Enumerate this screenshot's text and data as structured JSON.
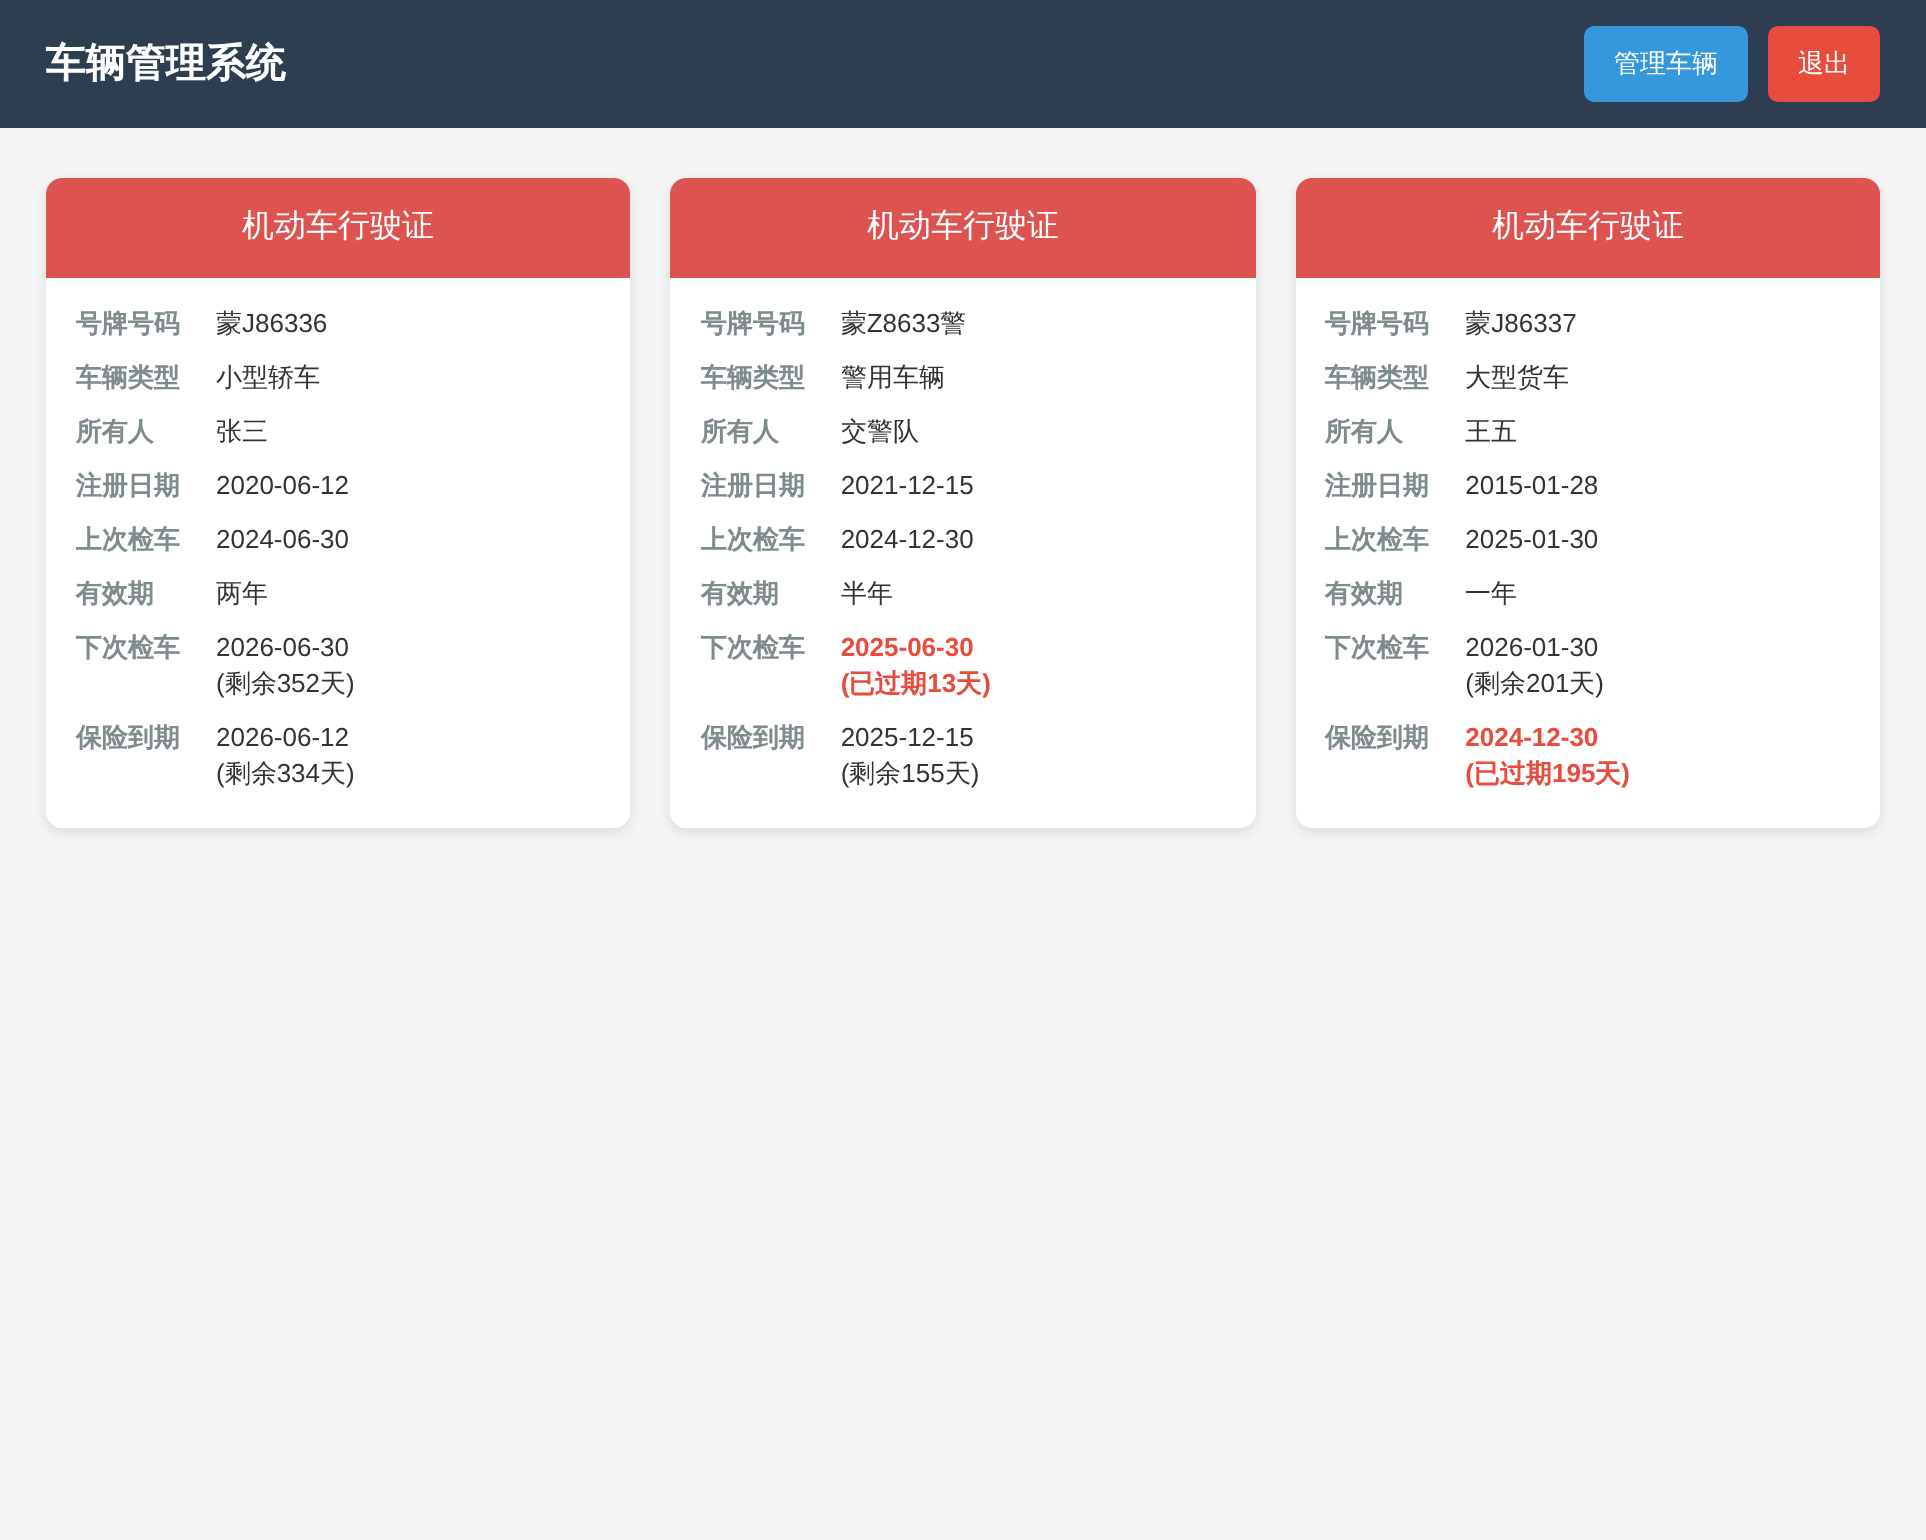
{
  "header": {
    "title": "车辆管理系统",
    "buttons": [
      {
        "label": "管理车辆",
        "kind": "primary"
      },
      {
        "label": "退出",
        "kind": "danger"
      }
    ]
  },
  "cards": [
    {
      "title": "机动车行驶证",
      "rows": [
        {
          "label": "号牌号码",
          "value": "蒙J86336",
          "expired": false
        },
        {
          "label": "车辆类型",
          "value": "小型轿车",
          "expired": false
        },
        {
          "label": "所有人",
          "value": "张三",
          "expired": false
        },
        {
          "label": "注册日期",
          "value": "2020-06-12",
          "expired": false
        },
        {
          "label": "上次检车",
          "value": "2024-06-30",
          "expired": false
        },
        {
          "label": "有效期",
          "value": "两年",
          "expired": false
        },
        {
          "label": "下次检车",
          "value": "2026-06-30",
          "note": "(剩余352天)",
          "expired": false
        },
        {
          "label": "保险到期",
          "value": "2026-06-12",
          "note": "(剩余334天)",
          "expired": false
        }
      ]
    },
    {
      "title": "机动车行驶证",
      "rows": [
        {
          "label": "号牌号码",
          "value": "蒙Z8633警",
          "expired": false
        },
        {
          "label": "车辆类型",
          "value": "警用车辆",
          "expired": false
        },
        {
          "label": "所有人",
          "value": "交警队",
          "expired": false
        },
        {
          "label": "注册日期",
          "value": "2021-12-15",
          "expired": false
        },
        {
          "label": "上次检车",
          "value": "2024-12-30",
          "expired": false
        },
        {
          "label": "有效期",
          "value": "半年",
          "expired": false
        },
        {
          "label": "下次检车",
          "value": "2025-06-30",
          "note": "(已过期13天)",
          "expired": true
        },
        {
          "label": "保险到期",
          "value": "2025-12-15",
          "note": "(剩余155天)",
          "expired": false
        }
      ]
    },
    {
      "title": "机动车行驶证",
      "rows": [
        {
          "label": "号牌号码",
          "value": "蒙J86337",
          "expired": false
        },
        {
          "label": "车辆类型",
          "value": "大型货车",
          "expired": false
        },
        {
          "label": "所有人",
          "value": "王五",
          "expired": false
        },
        {
          "label": "注册日期",
          "value": "2015-01-28",
          "expired": false
        },
        {
          "label": "上次检车",
          "value": "2025-01-30",
          "expired": false
        },
        {
          "label": "有效期",
          "value": "一年",
          "expired": false
        },
        {
          "label": "下次检车",
          "value": "2026-01-30",
          "note": "(剩余201天)",
          "expired": false
        },
        {
          "label": "保险到期",
          "value": "2024-12-30",
          "note": "(已过期195天)",
          "expired": true
        }
      ]
    }
  ]
}
